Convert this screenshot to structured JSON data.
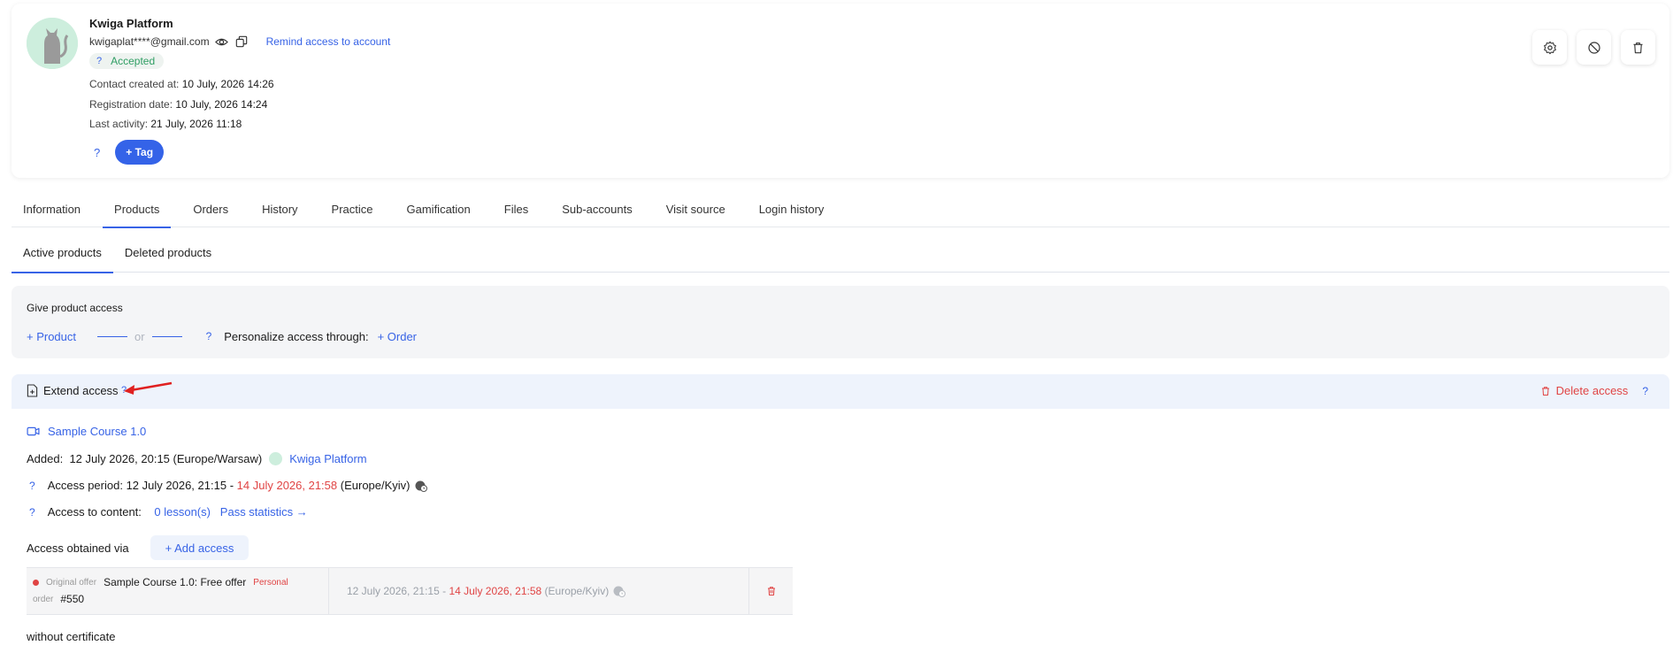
{
  "profile": {
    "name": "Kwiga Platform",
    "email": "kwigaplat****@gmail.com",
    "remind_label": "Remind access to account",
    "status_q": "?",
    "status": "Accepted",
    "created_label": "Contact created at:",
    "created_value": "10 July, 2026 14:26",
    "registration_label": "Registration date:",
    "registration_value": "10 July, 2026 14:24",
    "activity_label": "Last activity:",
    "activity_value": "21 July, 2026 11:18",
    "tag_q": "?",
    "tag_button": "+ Tag"
  },
  "tabs": [
    "Information",
    "Products",
    "Orders",
    "History",
    "Practice",
    "Gamification",
    "Files",
    "Sub-accounts",
    "Visit source",
    "Login history"
  ],
  "subtabs": [
    "Active products",
    "Deleted products"
  ],
  "give_access": {
    "title": "Give product access",
    "product_link": "+ Product",
    "or": "or",
    "q": "?",
    "personalize_label": "Personalize access through:",
    "order_link": "+ Order"
  },
  "access": {
    "extend_label": "Extend access",
    "extend_q": "?",
    "delete_label": "Delete access",
    "delete_q": "?",
    "course_name": "Sample Course 1.0",
    "added_label": "Added:",
    "added_value": "12 July 2026, 20:15",
    "added_tz": "(Europe/Warsaw)",
    "added_by": "Kwiga Platform",
    "period_q": "?",
    "period_label": "Access period:",
    "period_start": "12 July 2026, 21:15",
    "period_dash": "-",
    "period_end": "14 July 2026, 21:58",
    "period_tz": "(Europe/Kyiv)",
    "content_q": "?",
    "content_label": "Access to content:",
    "lessons_link": "0 lesson(s)",
    "stats_link": "Pass statistics →",
    "obtained_label": "Access obtained via",
    "add_access_button": "+ Add access",
    "offer_tag": "Original offer",
    "offer_name": "Sample Course 1.0: Free offer",
    "personal_tag": "Personal",
    "order_tag": "order",
    "order_number": "#550",
    "offer_start": "12 July 2026, 21:15",
    "offer_dash": "-",
    "offer_end": "14 July 2026, 21:58",
    "offer_tz": "(Europe/Kyiv)",
    "certificate": "without certificate"
  },
  "colors": {
    "accent": "#3763e6",
    "danger": "#e04444",
    "success": "#2f9e63"
  }
}
